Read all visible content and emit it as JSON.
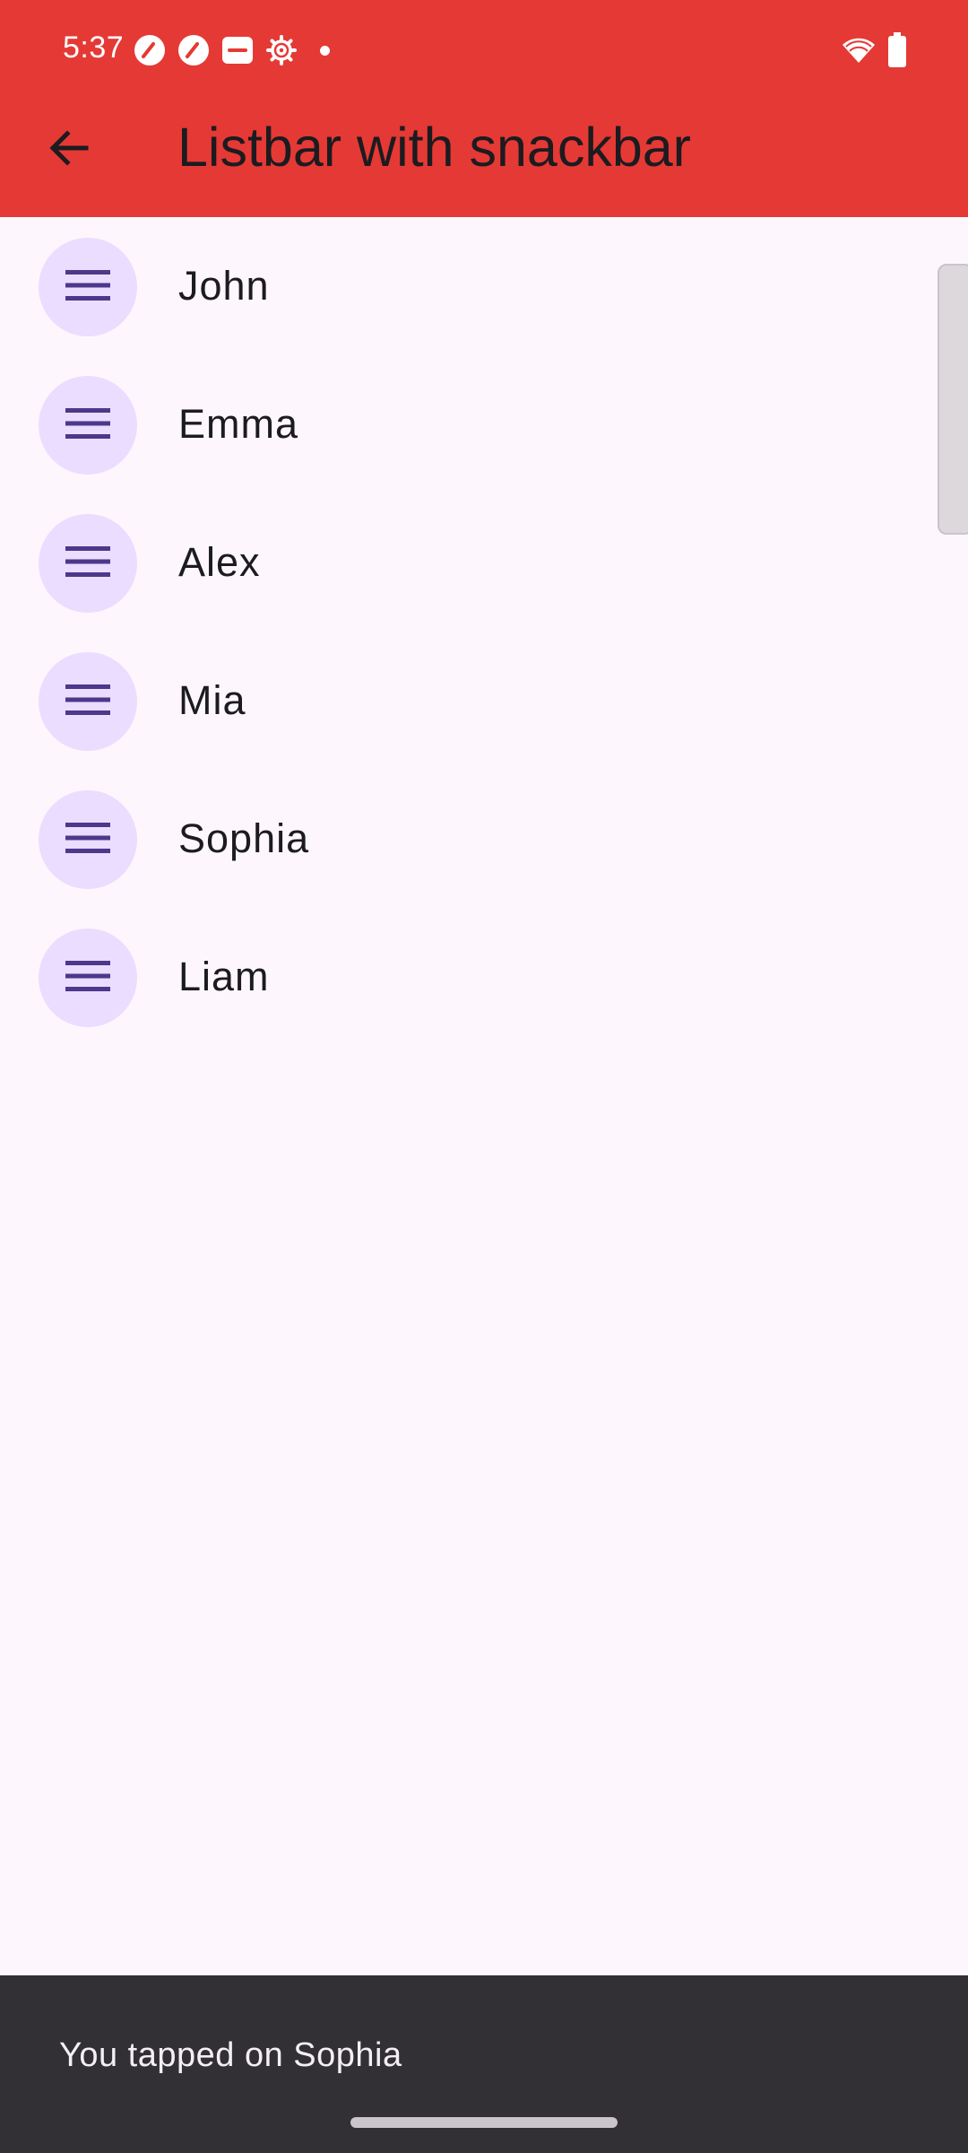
{
  "status_bar": {
    "time": "5:37",
    "icons": [
      "speedometer-icon",
      "speedometer-icon",
      "vivo-icon",
      "settings-gear-icon",
      "notification-dot-icon",
      "wifi-icon",
      "battery-icon"
    ]
  },
  "app_bar": {
    "title": "Listbar with snackbar",
    "back_icon": "arrow-back-icon",
    "color": "#e53935"
  },
  "list": {
    "items": [
      {
        "name": "John",
        "icon": "menu-lines-icon"
      },
      {
        "name": "Emma",
        "icon": "menu-lines-icon"
      },
      {
        "name": "Alex",
        "icon": "menu-lines-icon"
      },
      {
        "name": "Mia",
        "icon": "menu-lines-icon"
      },
      {
        "name": "Sophia",
        "icon": "menu-lines-icon"
      },
      {
        "name": "Liam",
        "icon": "menu-lines-icon"
      }
    ],
    "avatar_color": "#eaddff",
    "icon_color": "#4f378b"
  },
  "snackbar": {
    "message": "You tapped on Sophia"
  }
}
